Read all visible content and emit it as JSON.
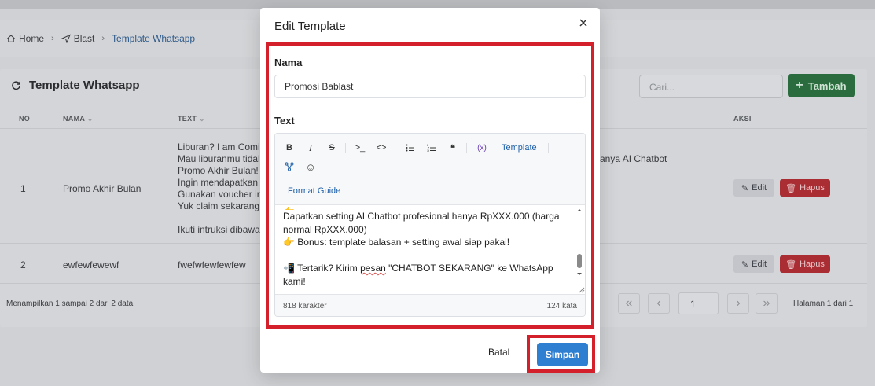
{
  "breadcrumb": {
    "home": "Home",
    "blast": "Blast",
    "current": "Template Whatsapp"
  },
  "panel": {
    "title": "Template Whatsapp",
    "search_placeholder": "Cari...",
    "add_button": "Tambah",
    "columns": {
      "no": "NO",
      "nama": "NAMA",
      "text": "TEXT",
      "aksi": "AKSI"
    },
    "rows": [
      {
        "no": "1",
        "nama": "Promo Akhir Bulan",
        "text_lines": [
          "Liburan? I am Comir",
          "Mau liburanmu tidal",
          "Promo Akhir Bulan!",
          "Ingin mendapatkan",
          "Gunakan voucher ir",
          "Yuk claim sekarang",
          "",
          "Ikuti intruksi dibawa"
        ],
        "text_tail": "anya AI Chatbot"
      },
      {
        "no": "2",
        "nama": "ewfewfewewf",
        "text_lines": [
          "fwefwfewfewfew"
        ],
        "text_tail": ""
      }
    ],
    "edit_label": "Edit",
    "hapus_label": "Hapus",
    "footer_info": "Menampilkan 1 sampai 2 dari 2 data",
    "page_value": "1",
    "page_label": "Halaman 1 dari 1"
  },
  "modal": {
    "title": "Edit Template",
    "nama_label": "Nama",
    "nama_value": "Promosi Bablast",
    "text_label": "Text",
    "toolbar": {
      "template": "Template",
      "format_guide": "Format Guide"
    },
    "content_lines": [
      {
        "emoji": "",
        "text": "Dapatkan setting AI Chatbot profesional hanya RpXXX.000 (harga normal RpXXX.000)"
      },
      {
        "emoji": "👉",
        "text": " Bonus: template balasan + setting awal siap pakai!"
      },
      {
        "emoji": "",
        "text": ""
      },
      {
        "emoji": "📲",
        "text": " Tertarik? Kirim "
      }
    ],
    "content_spell": "pesan",
    "content_after": " \"CHATBOT SEKARANG\" ke WhatsApp kami!",
    "char_count": "818 karakter",
    "word_count": "124 kata",
    "cancel_label": "Batal",
    "save_label": "Simpan"
  },
  "colors": {
    "primary": "#2e7fd1",
    "highlight": "#d4202a",
    "success": "#2b6c3f",
    "danger": "#a92d33"
  }
}
